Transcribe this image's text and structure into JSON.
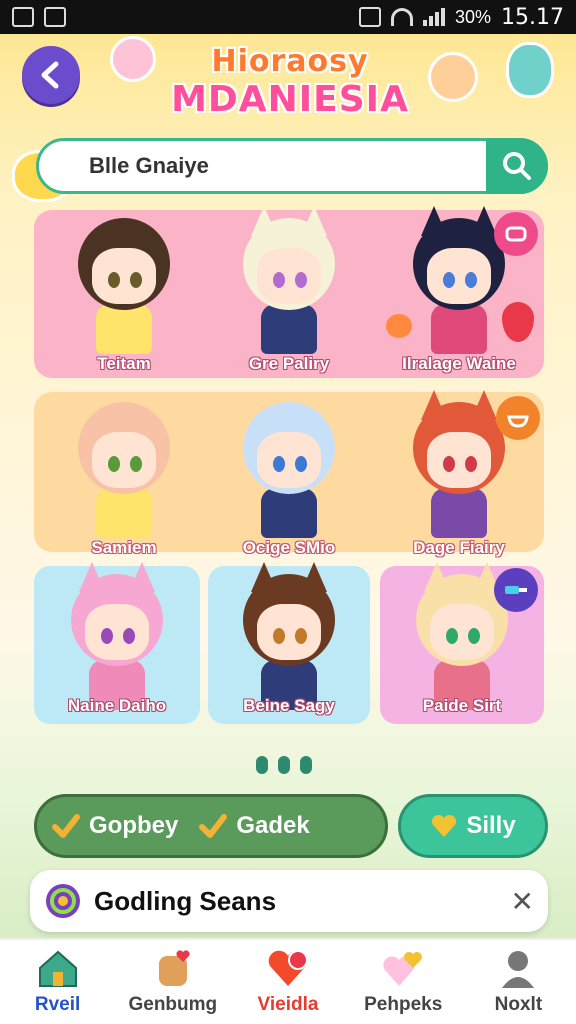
{
  "status_bar": {
    "battery": "30%",
    "time": "15.17"
  },
  "header": {
    "title_line1": "Hioraosy",
    "title_line2": "MDANIESIA"
  },
  "search": {
    "value": "Blle Gnaiye"
  },
  "characters_row1": [
    {
      "name": "Teitam"
    },
    {
      "name": "Gre Paliry"
    },
    {
      "name": "Ilralage Waine"
    }
  ],
  "characters_row2": [
    {
      "name": "Samiem"
    },
    {
      "name": "Ocige SMio"
    },
    {
      "name": "Dage Fiairy"
    }
  ],
  "characters_row3": [
    {
      "name": "Naine Daiho"
    },
    {
      "name": "Beine Sagy"
    },
    {
      "name": "Paide Sirt"
    }
  ],
  "categories": {
    "btn1": "Gopbey",
    "btn2": "Gadek",
    "btn3": "Silly"
  },
  "notice": {
    "label": "Godling Seans"
  },
  "bottom_nav": [
    {
      "label": "Rveil"
    },
    {
      "label": "Genbumg"
    },
    {
      "label": "Vieidla"
    },
    {
      "label": "Pehpeks"
    },
    {
      "label": "Noxlt"
    }
  ],
  "colors": {
    "accent_purple": "#6b4ccc",
    "accent_green": "#2fb48a",
    "row1_bg": "#fbb3c7",
    "row2_bg": "#ffdaa0"
  }
}
